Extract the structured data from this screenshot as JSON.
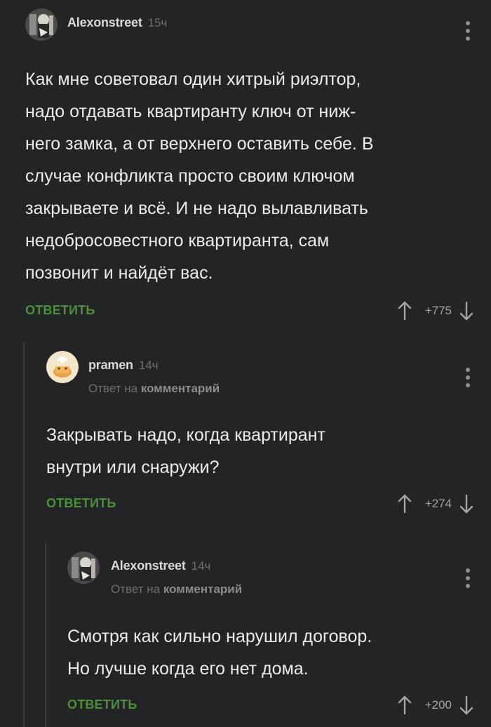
{
  "comments": [
    {
      "author": "Alexonstreet",
      "time": "15ч",
      "reply_to_prefix": "",
      "reply_to_target": "",
      "text": "Как мне советовал один хитрый риэлтор,\nнадо отдавать квартиранту ключ от ниж-\nнего замка, а от верхнего оставить себе. В\nслучае конфликта просто своим ключом\nзакрываете и всё. И не надо вылавливать\nнедобросовестного квартиранта, сам\nпозвонит и найдёт вас.",
      "reply_label": "ОТВЕТИТЬ",
      "rating": "+775"
    },
    {
      "author": "pramen",
      "time": "14ч",
      "reply_to_prefix": "Ответ на",
      "reply_to_target": "комментарий",
      "text": "Закрывать надо, когда квартирант\nвнутри или снаружи?",
      "reply_label": "ОТВЕТИТЬ",
      "rating": "+274"
    },
    {
      "author": "Alexonstreet",
      "time": "14ч",
      "reply_to_prefix": "Ответ на",
      "reply_to_target": "комментарий",
      "text": "Смотря как сильно нарушил договор.\nНо лучше когда его нет дома.",
      "reply_label": "ОТВЕТИТЬ",
      "rating": "+200"
    }
  ],
  "icons": {
    "menu": "more-vertical-icon",
    "upvote": "arrow-up-icon",
    "downvote": "arrow-down-icon"
  },
  "colors": {
    "background": "#222426",
    "reply_link": "#4b8f3a",
    "muted": "#6d6f72",
    "text": "#ebebeb"
  }
}
